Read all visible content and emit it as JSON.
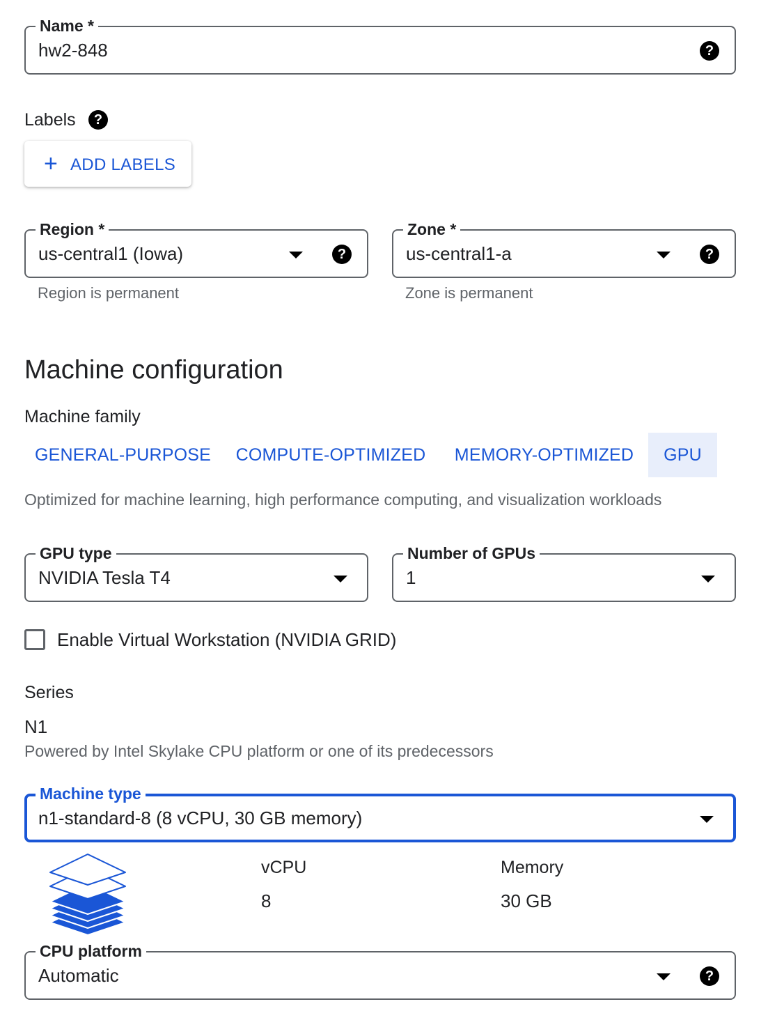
{
  "name_field": {
    "label": "Name *",
    "value": "hw2-848",
    "help_icon": "help-icon"
  },
  "labels": {
    "title": "Labels",
    "add_button": "ADD LABELS",
    "add_icon": "plus-icon"
  },
  "region": {
    "label": "Region *",
    "value": "us-central1 (Iowa)",
    "hint": "Region is permanent"
  },
  "zone": {
    "label": "Zone *",
    "value": "us-central1-a",
    "hint": "Zone is permanent"
  },
  "machine_config": {
    "heading": "Machine configuration",
    "family_label": "Machine family",
    "tabs": [
      {
        "label": "GENERAL-PURPOSE",
        "active": false
      },
      {
        "label": "COMPUTE-OPTIMIZED",
        "active": false
      },
      {
        "label": "MEMORY-OPTIMIZED",
        "active": false
      },
      {
        "label": "GPU",
        "active": true
      }
    ],
    "description": "Optimized for machine learning, high performance computing, and visualization workloads"
  },
  "gpu_type": {
    "label": "GPU type",
    "value": "NVIDIA Tesla T4"
  },
  "gpu_count": {
    "label": "Number of GPUs",
    "value": "1"
  },
  "virtual_workstation": {
    "label": "Enable Virtual Workstation (NVIDIA GRID)",
    "checked": false
  },
  "series": {
    "label": "Series",
    "value": "N1",
    "description": "Powered by Intel Skylake CPU platform or one of its predecessors"
  },
  "machine_type": {
    "label": "Machine type",
    "value": "n1-standard-8 (8 vCPU, 30 GB memory)"
  },
  "specs": {
    "icon": "layers-icon",
    "vcpu_label": "vCPU",
    "vcpu_value": "8",
    "memory_label": "Memory",
    "memory_value": "30 GB"
  },
  "cpu_platform": {
    "label": "CPU platform",
    "value": "Automatic"
  },
  "colors": {
    "accent": "#1a56d6",
    "active_tab_bg": "#e8eefb",
    "border": "#5f6368",
    "hint": "#5f6368"
  }
}
